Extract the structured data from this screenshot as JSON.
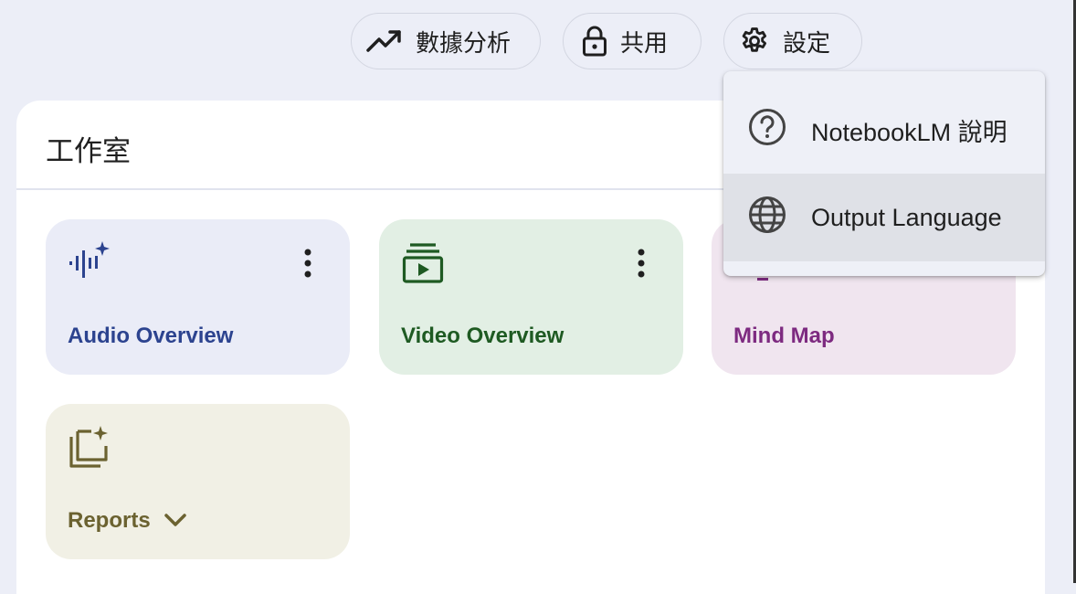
{
  "toolbar": {
    "analytics_label": "數據分析",
    "share_label": "共用",
    "settings_label": "設定"
  },
  "studio": {
    "title": "工作室",
    "cards": {
      "audio": {
        "label": "Audio Overview",
        "color": "#2c438f"
      },
      "video": {
        "label": "Video Overview",
        "color": "#1e5a22"
      },
      "mindmap": {
        "label": "Mind Map",
        "color": "#7d2a80"
      },
      "reports": {
        "label": "Reports",
        "color": "#6b6230"
      }
    }
  },
  "settings_menu": {
    "items": [
      {
        "label": "NotebookLM 說明",
        "icon": "help-circle-icon"
      },
      {
        "label": "Output Language",
        "icon": "globe-icon"
      }
    ]
  }
}
